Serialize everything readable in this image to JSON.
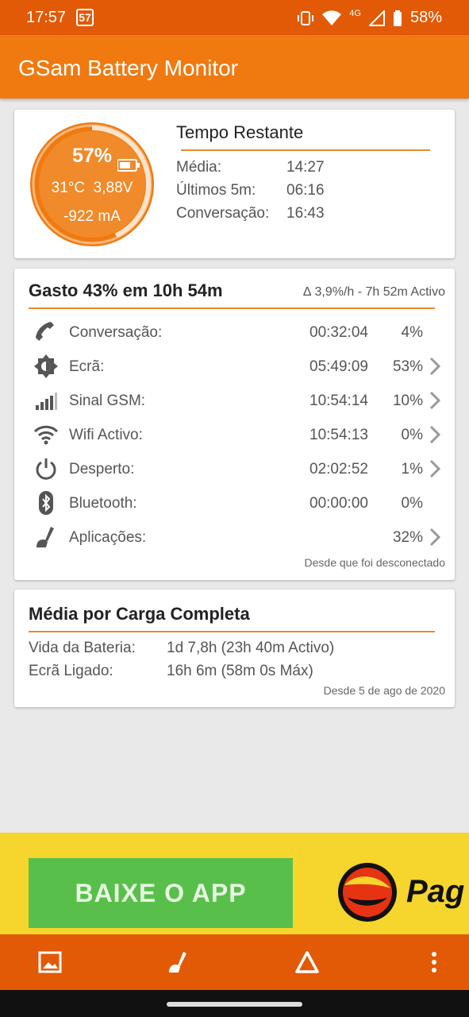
{
  "status_bar": {
    "time": "17:57",
    "notification_badge": "57",
    "network_type": "4G",
    "battery_percent": "58%"
  },
  "app_bar": {
    "title": "GSam Battery Monitor"
  },
  "summary": {
    "gauge": {
      "percent": "57%",
      "level": 0.57,
      "temperature": "31°C",
      "voltage": "3,88V",
      "current": "-922 mA",
      "color": "#f07a10"
    },
    "title": "Tempo Restante",
    "rows": [
      {
        "label": "Média:",
        "value": "14:27"
      },
      {
        "label": "Últimos 5m:",
        "value": "06:16"
      },
      {
        "label": "Conversação:",
        "value": "16:43"
      }
    ]
  },
  "usage": {
    "title": "Gasto 43% em 10h 54m",
    "delta": "∆ 3,9%/h - 7h 52m Activo",
    "rows": [
      {
        "icon": "phone-icon",
        "label": "Conversação:",
        "time": "00:32:04",
        "percent": "4%",
        "has_chevron": false
      },
      {
        "icon": "brightness-icon",
        "label": "Ecrã:",
        "time": "05:49:09",
        "percent": "53%",
        "has_chevron": true
      },
      {
        "icon": "signal-bars-icon",
        "label": "Sinal GSM:",
        "time": "10:54:14",
        "percent": "10%",
        "has_chevron": true
      },
      {
        "icon": "wifi-icon",
        "label": "Wifi Activo:",
        "time": "10:54:13",
        "percent": "0%",
        "has_chevron": true
      },
      {
        "icon": "power-icon",
        "label": "Desperto:",
        "time": "02:02:52",
        "percent": "1%",
        "has_chevron": true
      },
      {
        "icon": "bluetooth-icon",
        "label": "Bluetooth:",
        "time": "00:00:00",
        "percent": "0%",
        "has_chevron": false
      },
      {
        "icon": "apps-broom-icon",
        "label": "Aplicações:",
        "time": "",
        "percent": "32%",
        "has_chevron": true
      }
    ],
    "note": "Desde que foi desconectado"
  },
  "average": {
    "title": "Média por Carga Completa",
    "rows": [
      {
        "label": "Vida da Bateria:",
        "value": "1d 7,8h (23h 40m Activo)"
      },
      {
        "label": "Ecrã Ligado:",
        "value": "16h 6m (58m 0s Máx)"
      }
    ],
    "note": "Desde 5 de ago de 2020"
  },
  "ad": {
    "button_label": "BAIXE O APP",
    "brand": "Pag"
  },
  "bottom_bar": {
    "icons": [
      "image-icon",
      "broom-icon",
      "triangle-icon",
      "more-vert-icon"
    ]
  },
  "colors": {
    "accent": "#f07a10",
    "status_bar": "#e25a06",
    "divider": "#e98a2c",
    "ad_bg": "#f6d52c",
    "ad_button": "#58c04a"
  }
}
